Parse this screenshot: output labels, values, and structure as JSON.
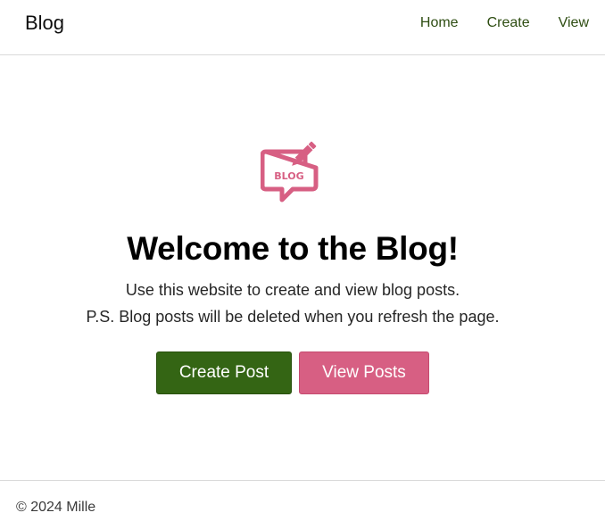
{
  "header": {
    "brand": "Blog",
    "nav": [
      {
        "label": "Home"
      },
      {
        "label": "Create"
      },
      {
        "label": "View"
      }
    ]
  },
  "hero": {
    "icon": "blog-speech-bubble-pencil-icon",
    "icon_text": "BLOG",
    "title": "Welcome to the Blog!",
    "line1": "Use this website to create and view blog posts.",
    "line2": "P.S. Blog posts will be deleted when you refresh the page.",
    "primary_button": "Create Post",
    "secondary_button": "View Posts"
  },
  "footer": {
    "copyright": "© 2024 Mille"
  },
  "colors": {
    "primary": "#346514",
    "secondary": "#d75f83",
    "nav_text": "#2e4d12",
    "icon": "#d75f83"
  }
}
